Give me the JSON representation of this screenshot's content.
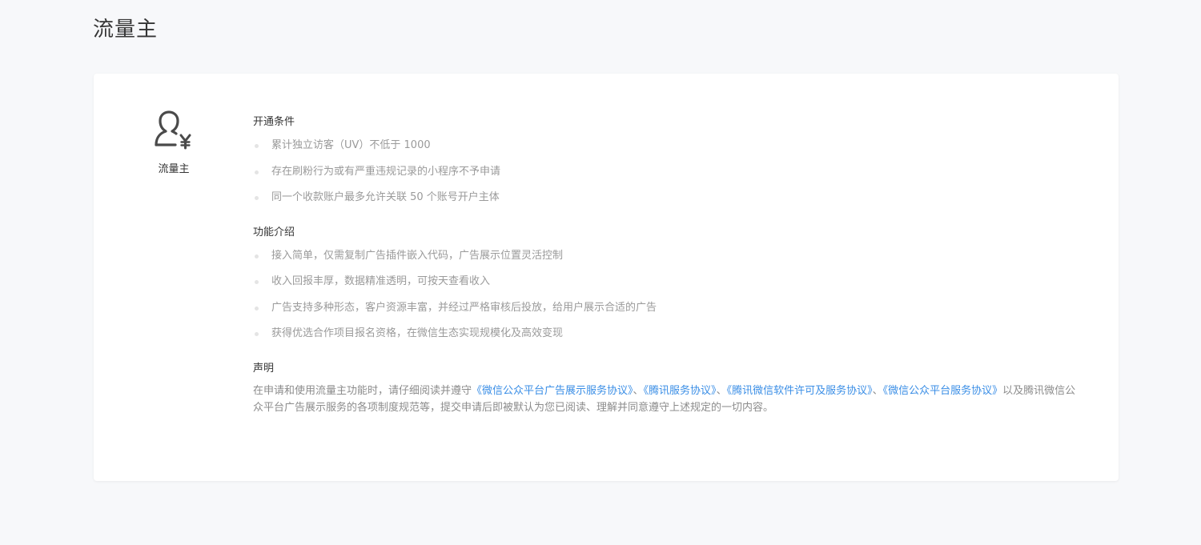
{
  "page": {
    "title": "流量主"
  },
  "role": {
    "name": "流量主",
    "icon": "user-yen-icon"
  },
  "sections": {
    "conditions": {
      "title": "开通条件",
      "items": [
        "累计独立访客（UV）不低于 1000",
        "存在刷粉行为或有严重违规记录的小程序不予申请",
        "同一个收款账户最多允许关联 50 个账号开户主体"
      ]
    },
    "features": {
      "title": "功能介绍",
      "items": [
        "接入简单，仅需复制广告插件嵌入代码，广告展示位置灵活控制",
        "收入回报丰厚，数据精准透明，可按天查看收入",
        "广告支持多种形态，客户资源丰富，并经过严格审核后投放，给用户展示合适的广告",
        "获得优选合作项目报名资格，在微信生态实现规模化及高效变现"
      ]
    },
    "statement": {
      "title": "声明",
      "prefix": "在申请和使用流量主功能时，请仔细阅读并遵守",
      "link1": "《微信公众平台广告展示服务协议》",
      "sep1": "、",
      "link2": "《腾讯服务协议》",
      "sep2": "、",
      "link3": "《腾讯微信软件许可及服务协议》",
      "sep3": "、",
      "link4": "《微信公众平台服务协议》",
      "suffix": "以及腾讯微信公众平台广告展示服务的各项制度规范等，提交申请后即被默认为您已阅读、理解并同意遵守上述规定的一切内容。"
    }
  },
  "colors": {
    "link": "#3a8ee6",
    "muted_text": "#9a9a9a",
    "background": "#f7f8fa"
  }
}
